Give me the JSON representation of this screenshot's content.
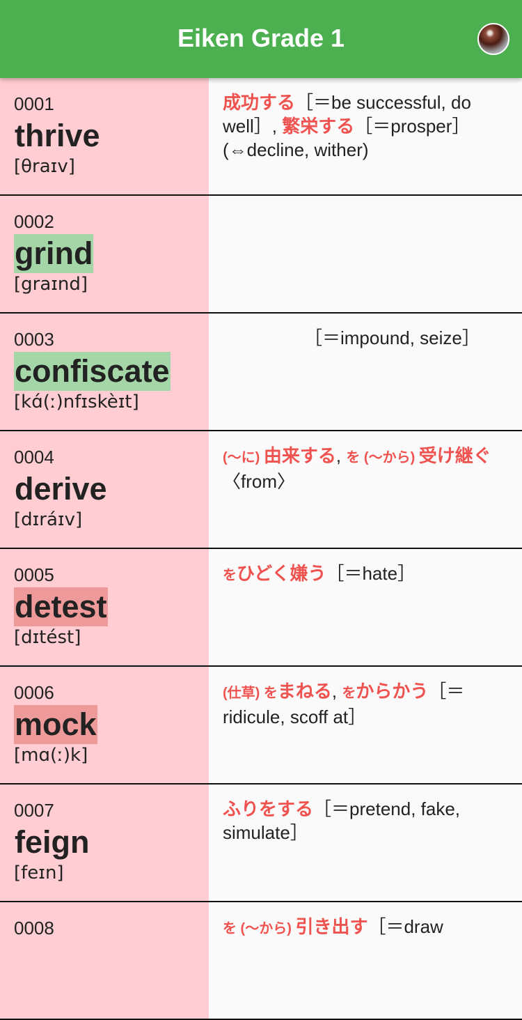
{
  "app_bar": {
    "title": "Eiken Grade 1",
    "avatar_icon": "user-avatar"
  },
  "colors": {
    "app_bar": "#4caf50",
    "word_panel": "#ffcdd2",
    "highlight_known": "#a5d6a7",
    "highlight_unknown": "#ef9a9a",
    "japanese_text": "#ef5350"
  },
  "words": [
    {
      "number": "0001",
      "word": "thrive",
      "pronunciation": "[θraɪv]",
      "highlight": "none",
      "meaning": [
        {
          "t": "成功する",
          "jp": true
        },
        {
          "t": "［＝be successful, do well］, "
        },
        {
          "t": "繁栄する",
          "jp": true
        },
        {
          "t": "［＝prosper］(⇔decline, wither)"
        }
      ]
    },
    {
      "number": "0002",
      "word": "grind",
      "pronunciation": "[graɪnd]",
      "highlight": "green",
      "meaning": []
    },
    {
      "number": "0003",
      "word": "confiscate",
      "pronunciation": "[kɑ́(ː)nfɪskèɪt]",
      "highlight": "green",
      "meaning": [
        {
          "t": "　　　　　［＝impound, seize］"
        }
      ]
    },
    {
      "number": "0004",
      "word": "derive",
      "pronunciation": "[dɪráɪv]",
      "highlight": "none",
      "meaning": [
        {
          "t": "(〜に) ",
          "jp": true,
          "sm": true
        },
        {
          "t": "由来する",
          "jp": true
        },
        {
          "t": ", "
        },
        {
          "t": "を (〜から) ",
          "jp": true,
          "sm": true
        },
        {
          "t": "受け継ぐ",
          "jp": true
        },
        {
          "t": "〈from〉"
        }
      ]
    },
    {
      "number": "0005",
      "word": "detest",
      "pronunciation": "[dɪtést]",
      "highlight": "red",
      "meaning": [
        {
          "t": "を",
          "jp": true,
          "sm": true
        },
        {
          "t": "ひどく嫌う",
          "jp": true
        },
        {
          "t": "［＝hate］"
        }
      ]
    },
    {
      "number": "0006",
      "word": "mock",
      "pronunciation": "[mɑ(ː)k]",
      "highlight": "red",
      "meaning": [
        {
          "t": "(仕草) を",
          "jp": true,
          "sm": true
        },
        {
          "t": "まねる",
          "jp": true
        },
        {
          "t": ", "
        },
        {
          "t": "を",
          "jp": true,
          "sm": true
        },
        {
          "t": "からかう",
          "jp": true
        },
        {
          "t": "［＝ridicule, scoff at］"
        }
      ]
    },
    {
      "number": "0007",
      "word": "feign",
      "pronunciation": "[feɪn]",
      "highlight": "none",
      "meaning": [
        {
          "t": "ふりをする",
          "jp": true
        },
        {
          "t": "［＝pretend, fake, simulate］"
        }
      ]
    },
    {
      "number": "0008",
      "word": "",
      "pronunciation": "",
      "highlight": "none",
      "meaning": [
        {
          "t": "を (〜から) ",
          "jp": true,
          "sm": true
        },
        {
          "t": "引き出す",
          "jp": true
        },
        {
          "t": "［＝draw"
        }
      ]
    }
  ]
}
